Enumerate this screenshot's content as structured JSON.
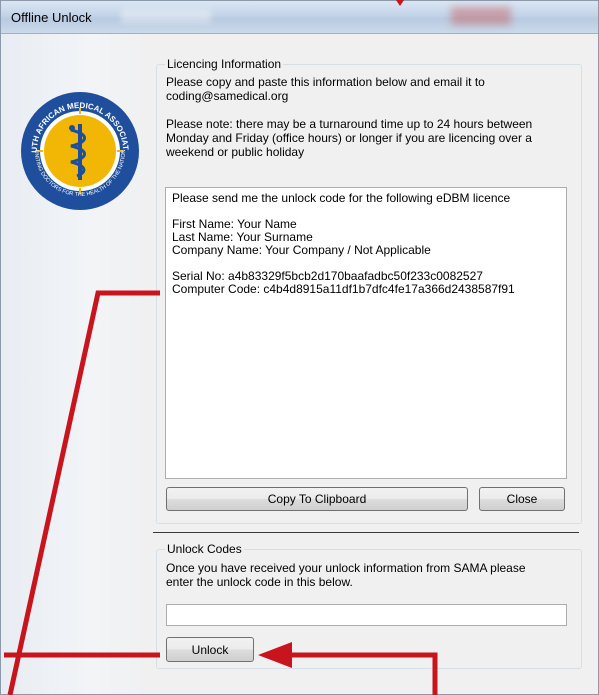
{
  "window": {
    "title": "Offline Unlock"
  },
  "licencing": {
    "group_label": "Licencing Information",
    "intro_line1": "Please copy and paste this information below and email it to",
    "intro_line2": "coding@samedical.org",
    "note_line1": "Please note:  there may be a turnaround time up to 24 hours between",
    "note_line2": "Monday and Friday (office hours) or longer if you are licencing over a",
    "note_line3": "weekend or public holiday",
    "textarea": {
      "header": "Please send me the unlock code for the following eDBM licence",
      "first_name": "First Name: Your Name",
      "last_name": "Last Name: Your Surname",
      "company": "Company Name: Your Company / Not Applicable",
      "serial": "Serial No: a4b83329f5bcb2d170baafadbc50f233c0082527",
      "computer_code": "Computer Code: c4b4d8915a11df1b7dfc4fe17a366d2438587f91"
    },
    "copy_button": "Copy To Clipboard",
    "close_button": "Close"
  },
  "unlock": {
    "group_label": "Unlock Codes",
    "instruction_line1": "Once you have received your unlock information from SAMA please",
    "instruction_line2": "enter the unlock code in this below.",
    "code_value": "",
    "unlock_button": "Unlock"
  },
  "logo": {
    "top_text": "SOUTH AFRICAN MEDICAL ASSOCIATION",
    "bottom_text": "UNITING DOCTORS FOR THE HEALTH OF THE NATION"
  },
  "colors": {
    "logo_ring": "#1f4f9c",
    "logo_sun": "#f2b705",
    "annotation": "#c8141c"
  }
}
